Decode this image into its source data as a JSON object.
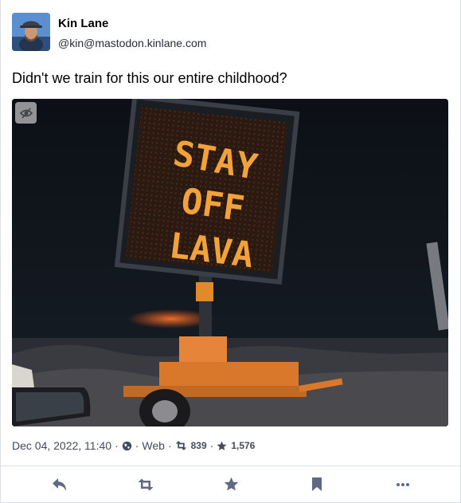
{
  "author": {
    "display_name": "Kin Lane",
    "handle": "@kin@mastodon.kinlane.com"
  },
  "post": {
    "text": "Didn't we train for this our entire childhood?",
    "media_sign_lines": [
      "STAY",
      "OFF",
      "LAVA"
    ]
  },
  "meta": {
    "date": "Dec 04, 2022, 11:40",
    "visibility_icon": "globe-icon",
    "application": "Web",
    "boosts": "839",
    "favourites": "1,576"
  },
  "actions": [
    {
      "name": "reply-button",
      "icon": "reply-icon"
    },
    {
      "name": "boost-button",
      "icon": "retweet-icon"
    },
    {
      "name": "favourite-button",
      "icon": "star-icon"
    },
    {
      "name": "bookmark-button",
      "icon": "bookmark-icon"
    },
    {
      "name": "more-button",
      "icon": "ellipsis-icon"
    }
  ],
  "colors": {
    "text_secondary": "#444b5d",
    "icon_color": "#606984",
    "border": "#d9e1e8",
    "sign_led": "#f2a23a"
  }
}
